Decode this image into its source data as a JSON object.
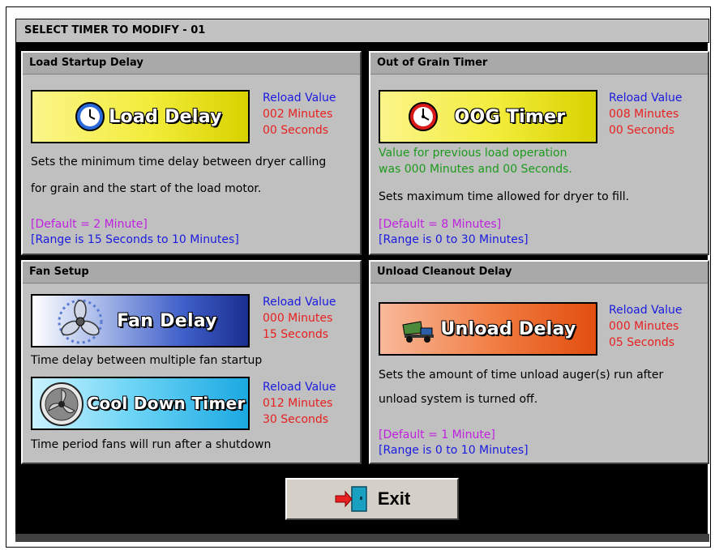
{
  "title": "SELECT TIMER TO MODIFY - 01",
  "panels": {
    "load": {
      "header": "Load Startup Delay",
      "button": "Load Delay",
      "reload": [
        "Reload Value",
        "002 Minutes",
        "00 Seconds"
      ],
      "desc1": "Sets the minimum time delay between dryer calling",
      "desc2": "for grain and the start of the load motor.",
      "default": "[Default = 2 Minute]",
      "range": "[Range is 15 Seconds to 10 Minutes]"
    },
    "oog": {
      "header": "Out of Grain Timer",
      "button": "OOG Timer",
      "reload": [
        "Reload Value",
        "008 Minutes",
        "00 Seconds"
      ],
      "prev1": "Value for previous load operation",
      "prev2": "was 000 Minutes and 00 Seconds.",
      "desc": "Sets maximum time allowed for dryer to fill.",
      "default": "[Default = 8 Minutes]",
      "range": "[Range is 0 to 30 Minutes]"
    },
    "fan": {
      "header": "Fan Setup",
      "fan_button": "Fan Delay",
      "fan_reload": [
        "Reload Value",
        "000 Minutes",
        "15 Seconds"
      ],
      "fan_desc": "Time delay between multiple fan startup",
      "cool_button": "Cool Down Timer",
      "cool_reload": [
        "Reload Value",
        "012 Minutes",
        "30 Seconds"
      ],
      "cool_desc": "Time period fans will run after a shutdown"
    },
    "unload": {
      "header": "Unload Cleanout Delay",
      "button": "Unload Delay",
      "reload": [
        "Reload Value",
        "000 Minutes",
        "05 Seconds"
      ],
      "desc1": "Sets the amount of time unload auger(s) run after",
      "desc2": "unload system is turned off.",
      "default": "[Default = 1 Minute]",
      "range": "[Range is 0 to 10 Minutes]"
    }
  },
  "exit_label": "Exit",
  "icons": {
    "load": "clock-icon",
    "oog": "stopwatch-icon",
    "fan": "fan-icon",
    "cool": "cooling-fan-icon",
    "unload": "dump-truck-icon",
    "exit": "exit-door-icon"
  },
  "colors": {
    "reload_label": "#1a1ae0",
    "reload_value": "#e82020",
    "previous_value": "#1d9a1d",
    "default_text": "#c020e0",
    "range_text": "#1a1ae0"
  }
}
